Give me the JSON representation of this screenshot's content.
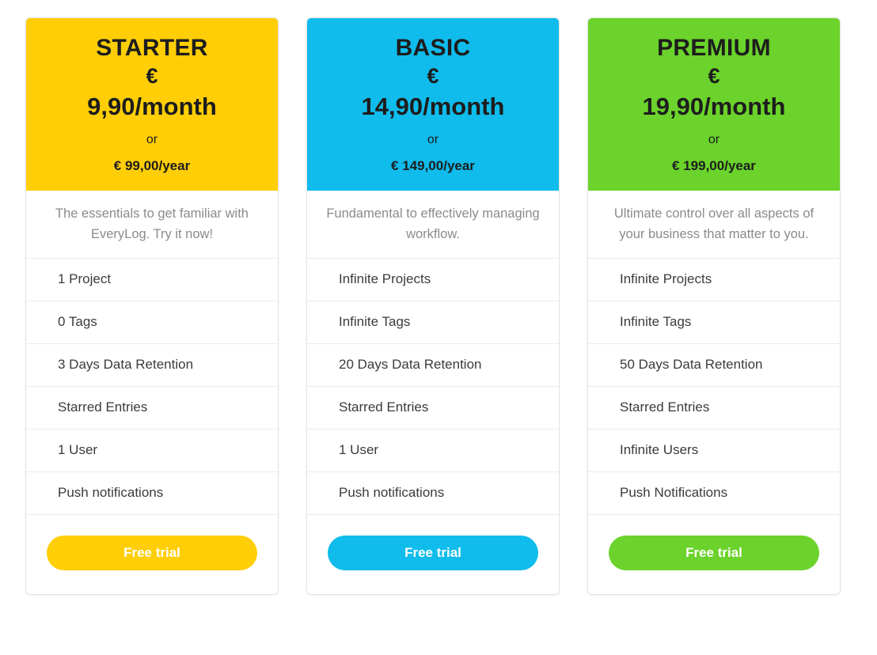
{
  "page": {
    "background": "#ffffff"
  },
  "plans": [
    {
      "id": "starter",
      "name": "STARTER",
      "currency": "€",
      "price_monthly": "9,90/month",
      "or_label": "or",
      "price_yearly": "€ 99,00/year",
      "description": "The essentials to get familiar with EveryLog. Try it now!",
      "accent_color": "#FFCE06",
      "header_text_color": "#1d1d1d",
      "features": [
        "1 Project",
        "0 Tags",
        "3 Days Data Retention",
        "Starred Entries",
        "1 User",
        "Push notifications"
      ],
      "cta_label": "Free trial"
    },
    {
      "id": "basic",
      "name": "BASIC",
      "currency": "€",
      "price_monthly": "14,90/month",
      "or_label": "or",
      "price_yearly": "€ 149,00/year",
      "description": "Fundamental to effectively managing workflow.",
      "accent_color": "#0FBCEC",
      "header_text_color": "#1d1d1d",
      "features": [
        "Infinite Projects",
        "Infinite Tags",
        "20 Days Data Retention",
        "Starred Entries",
        "1 User",
        "Push notifications"
      ],
      "cta_label": "Free trial"
    },
    {
      "id": "premium",
      "name": "PREMIUM",
      "currency": "€",
      "price_monthly": "19,90/month",
      "or_label": "or",
      "price_yearly": "€ 199,00/year",
      "description": "Ultimate control over all aspects of your business that matter to you.",
      "accent_color": "#6BD32B",
      "header_text_color": "#1d1d1d",
      "features": [
        "Infinite Projects",
        "Infinite Tags",
        "50 Days Data Retention",
        "Starred Entries",
        "Infinite Users",
        "Push Notifications"
      ],
      "cta_label": "Free trial"
    }
  ]
}
